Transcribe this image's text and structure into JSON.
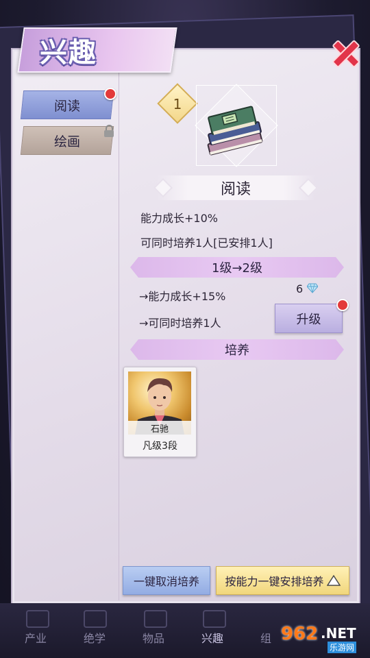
{
  "header": {
    "title": "兴趣"
  },
  "sidebar": {
    "items": [
      {
        "label": "阅读",
        "has_red_dot": true
      },
      {
        "label": "绘画",
        "locked": true
      }
    ]
  },
  "skill": {
    "level": "1",
    "name": "阅读",
    "icon": "books-icon",
    "effect_1": "能力成长+10%",
    "effect_2": "可同时培养1人[已安排1人]"
  },
  "upgrade": {
    "band_label": "1级→2级",
    "next_effect_1": "→能力成长+15%",
    "next_effect_2": "→可同时培养1人",
    "cost": "6",
    "cost_icon": "diamond-icon",
    "button_label": "升级"
  },
  "training": {
    "band_label": "培养",
    "characters": [
      {
        "name": "石驰",
        "rank": "凡级3段"
      }
    ]
  },
  "actions": {
    "cancel_all": "一键取消培养",
    "auto_assign": "按能力一键安排培养"
  },
  "nav": {
    "items": [
      "产业",
      "绝学",
      "物品",
      "兴趣",
      "组"
    ]
  },
  "watermark": {
    "number": "962",
    "domain": ".NET",
    "site": "乐游网"
  },
  "colors": {
    "accent_purple": "#dcb8ea",
    "red_dot": "#e33a3a",
    "gold": "#f1d67c",
    "blue_button": "#93ace3"
  }
}
